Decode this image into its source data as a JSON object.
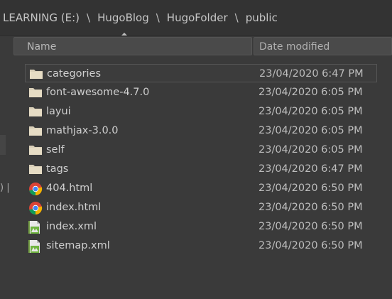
{
  "breadcrumb": [
    "LEARNING (E:)",
    "HugoBlog",
    "HugoFolder",
    "public"
  ],
  "separator": "\\",
  "columns": {
    "name": "Name",
    "date": "Date modified"
  },
  "files": [
    {
      "name": "categories",
      "date": "23/04/2020 6:47 PM",
      "icon": "folder-icon"
    },
    {
      "name": "font-awesome-4.7.0",
      "date": "23/04/2020 6:05 PM",
      "icon": "folder-icon"
    },
    {
      "name": "layui",
      "date": "23/04/2020 6:05 PM",
      "icon": "folder-icon"
    },
    {
      "name": "mathjax-3.0.0",
      "date": "23/04/2020 6:05 PM",
      "icon": "folder-icon"
    },
    {
      "name": "self",
      "date": "23/04/2020 6:05 PM",
      "icon": "folder-icon"
    },
    {
      "name": "tags",
      "date": "23/04/2020 6:47 PM",
      "icon": "folder-icon"
    },
    {
      "name": "404.html",
      "date": "23/04/2020 6:50 PM",
      "icon": "chrome-icon"
    },
    {
      "name": "index.html",
      "date": "23/04/2020 6:50 PM",
      "icon": "chrome-icon"
    },
    {
      "name": "index.xml",
      "date": "23/04/2020 6:50 PM",
      "icon": "xml-file-icon"
    },
    {
      "name": "sitemap.xml",
      "date": "23/04/2020 6:50 PM",
      "icon": "xml-file-icon"
    }
  ],
  "left_stub_text": ") |"
}
